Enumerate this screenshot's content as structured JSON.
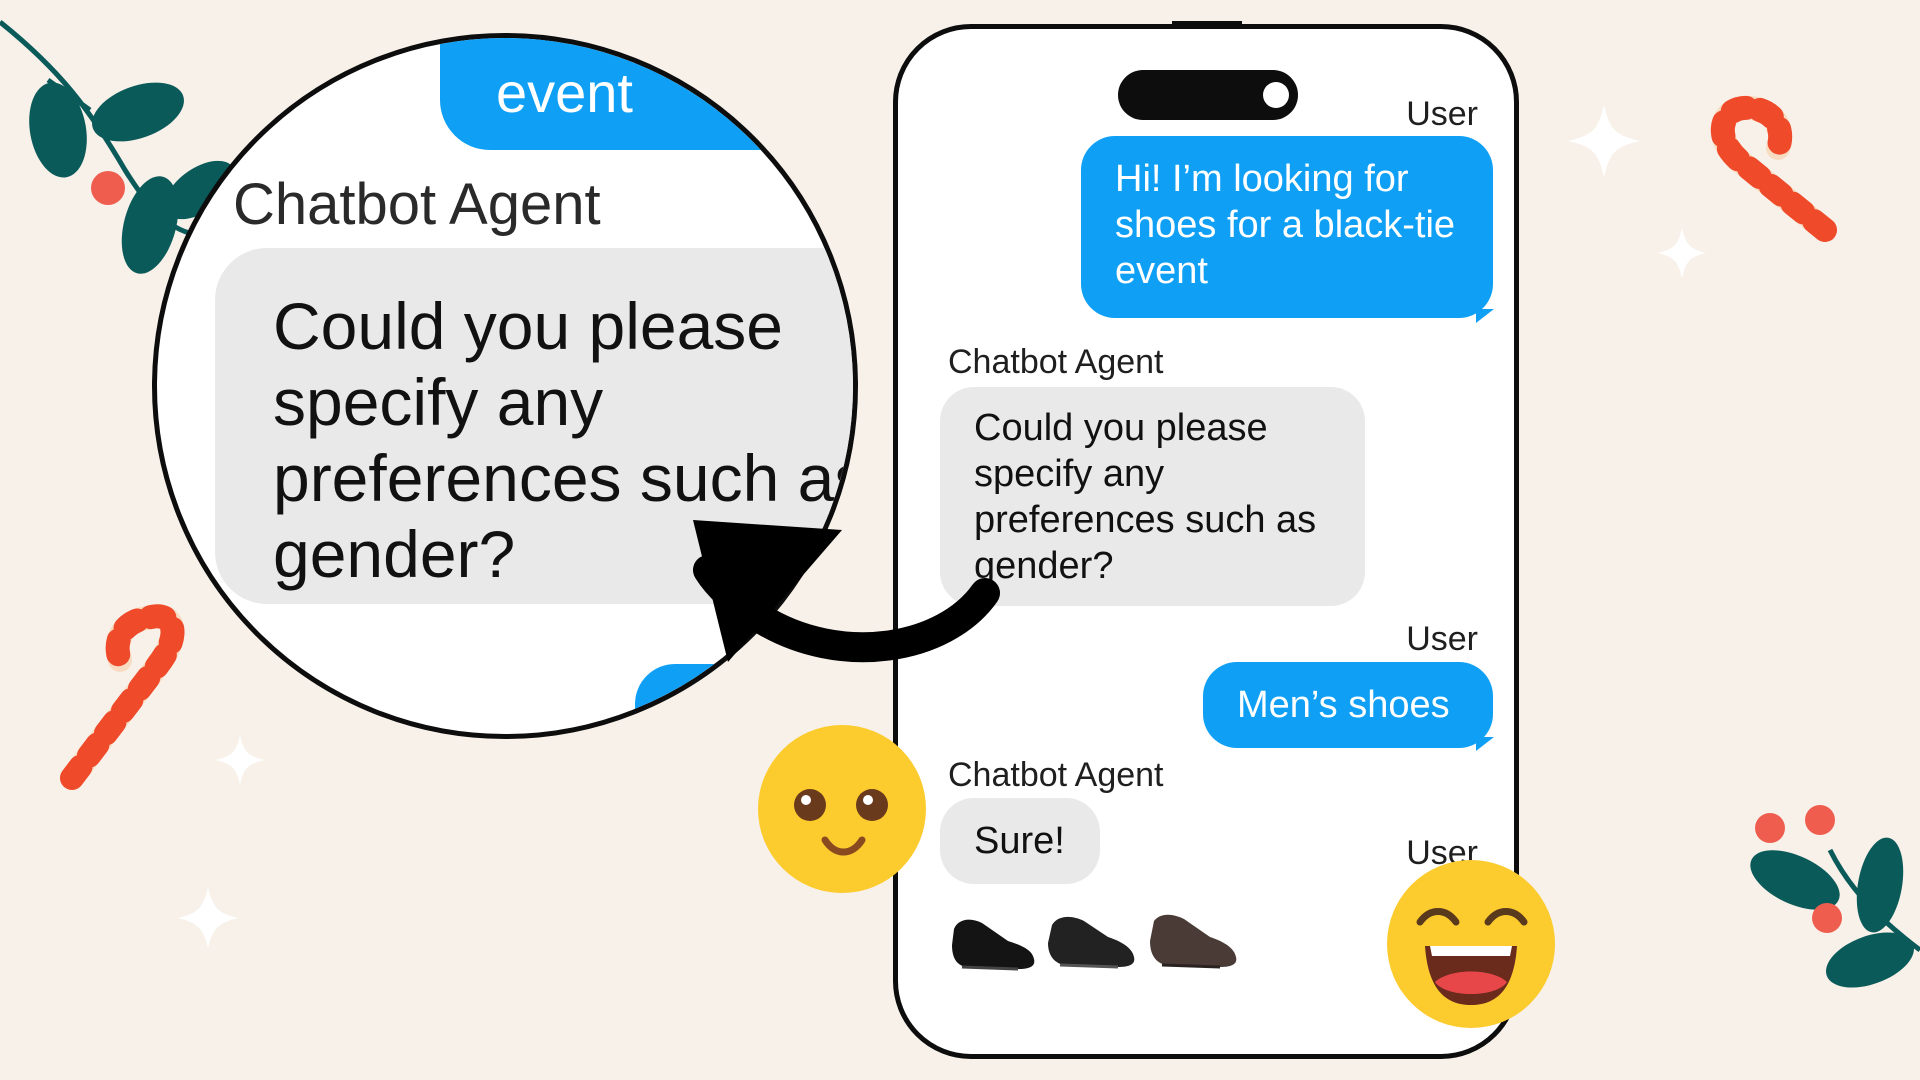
{
  "chat": {
    "messages": [
      {
        "sender": "User",
        "role": "user",
        "text": "Hi! I’m looking for shoes for a black-tie event"
      },
      {
        "sender": "Chatbot Agent",
        "role": "agent",
        "text": "Could you please specify any preferences such as gender?"
      },
      {
        "sender": "User",
        "role": "user",
        "text": "Men’s shoes"
      },
      {
        "sender": "Chatbot Agent",
        "role": "agent",
        "text": "Sure!"
      },
      {
        "sender": "User",
        "role": "user",
        "text": ""
      }
    ],
    "product_thumbnails": [
      "black-oxford-shoe",
      "black-loafer-shoe",
      "brown-oxford-shoe"
    ]
  },
  "magnifier": {
    "prev_bubble_text": "event",
    "sender": "Chatbot Agent",
    "text": "Could you please specify any preferences such as gender?"
  },
  "colors": {
    "user_bubble": "#0fa0f5",
    "agent_bubble": "#e9e9e9",
    "background": "#f8f1ea",
    "emoji_yellow": "#fccb2e"
  },
  "icons": [
    "smiling-emoji-icon",
    "grinning-emoji-icon",
    "curved-arrow-icon",
    "candy-cane-icon",
    "mistletoe-icon",
    "sparkle-icon"
  ]
}
